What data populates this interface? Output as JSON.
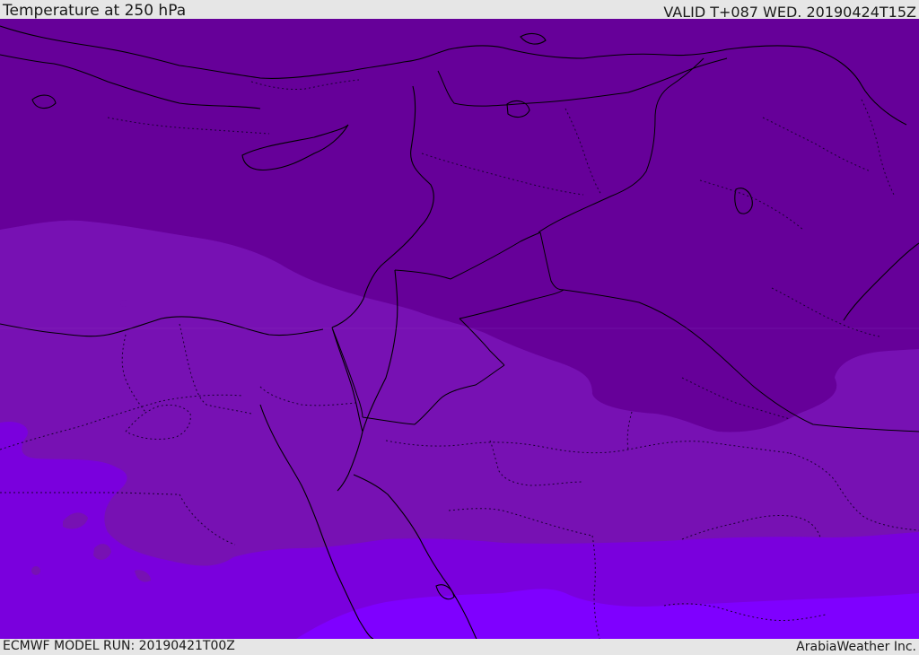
{
  "header": {
    "title": "Temperature at 250 hPa",
    "valid": "VALID T+087 WED. 20190424T15Z"
  },
  "footer": {
    "model_run": "ECMWF MODEL RUN: 20190421T00Z",
    "credit": "ArabiaWeather Inc."
  },
  "map": {
    "fill_colors": {
      "coldest": "#660099",
      "cold": "#7711b3",
      "mild": "#7a00dd",
      "warm": "#7f00ff"
    },
    "line_colors": {
      "coastline": "#000000",
      "border": "#1a0033"
    }
  }
}
